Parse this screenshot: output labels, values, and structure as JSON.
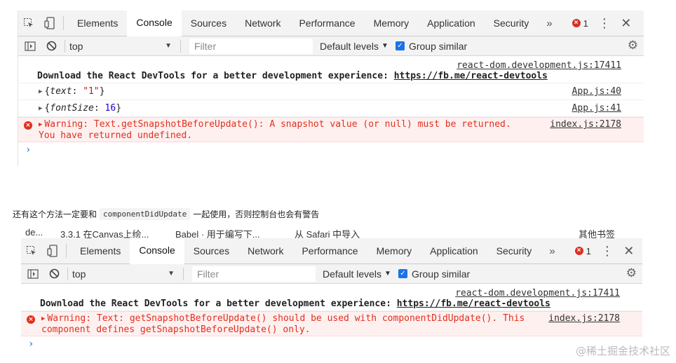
{
  "devtools_tabs": [
    "Elements",
    "Console",
    "Sources",
    "Network",
    "Performance",
    "Memory",
    "Application",
    "Security"
  ],
  "active_tab": "Console",
  "more_tabs": "»",
  "error_count": "1",
  "context": "top",
  "filter_placeholder": "Filter",
  "levels_label": "Default levels",
  "group_similar_label": "Group similar",
  "panel1": {
    "devtools_src": "react-dom.development.js:17411",
    "devtools_msg": "Download the React DevTools for a better development experience: ",
    "devtools_link": "https://fb.me/react-devtools",
    "log1_key": "text",
    "log1_value": "\"1\"",
    "log1_src": "App.js:40",
    "log2_key": "fontSize",
    "log2_value": "16",
    "log2_src": "App.js:41",
    "warn_line1": "Warning: Text.getSnapshotBeforeUpdate(): A snapshot value (or null) must be returned.",
    "warn_line2": "You have returned undefined.",
    "warn_src": "index.js:2178"
  },
  "caption": {
    "before": "还有这个方法一定要和",
    "code": "componentDidUpdate",
    "after": "一起使用，否则控制台也会有警告"
  },
  "browser_tabstrip": [
    "de...",
    "3.3.1 在Canvas上绘...",
    "Babel · 用于编写下...",
    "从 Safari 中导入",
    "其他书签"
  ],
  "panel2": {
    "devtools_src": "react-dom.development.js:17411",
    "devtools_msg": "Download the React DevTools for a better development experience: ",
    "devtools_link": "https://fb.me/react-devtools",
    "warn_line1": "Warning: Text: getSnapshotBeforeUpdate() should be used with componentDidUpdate(). This",
    "warn_line2": "component defines getSnapshotBeforeUpdate() only.",
    "warn_src": "index.js:2178"
  },
  "watermark": "@稀土掘金技术社区",
  "colors": {
    "error_red": "#e0301e",
    "warning_bg": "#fff0f0",
    "checkbox_blue": "#1a73e8"
  }
}
